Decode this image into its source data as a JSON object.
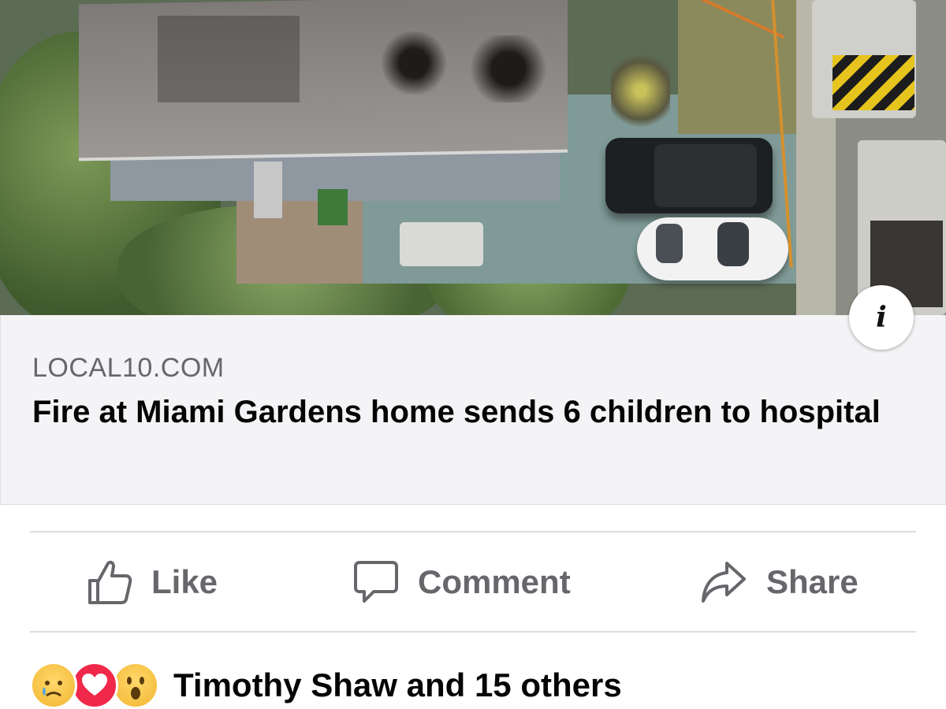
{
  "post": {
    "link_preview": {
      "domain": "LOCAL10.COM",
      "title": "Fire at Miami Gardens home sends 6 children to hospital",
      "image": "aerial-photo-of-fire-damaged-house"
    },
    "actions": {
      "like_label": "Like",
      "comment_label": "Comment",
      "share_label": "Share"
    },
    "reactions": {
      "icons": [
        "sad-reaction-icon",
        "love-reaction-icon",
        "wow-reaction-icon"
      ],
      "summary": "Timothy Shaw and 15 others"
    },
    "info_icon": "info-icon"
  },
  "colors": {
    "card_background": "#f4f4f6",
    "muted_text": "#65676b",
    "primary_text": "#050505",
    "love_red": "#f0284a",
    "haha_yellow": "#f7c84a"
  }
}
